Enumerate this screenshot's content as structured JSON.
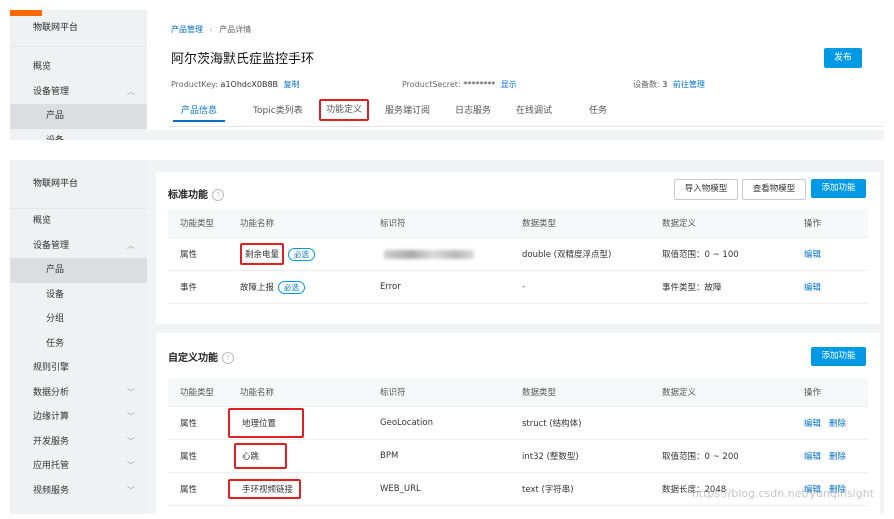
{
  "top": {
    "brand": "物联网平台",
    "nav": [
      "概览",
      "设备管理",
      "产品",
      "设备"
    ],
    "breadcrumb": {
      "parent": "产品管理",
      "sep": "›",
      "current": "产品详情"
    },
    "title": "阿尔茨海默氏症监控手环",
    "publish": "发布",
    "product_key_label": "ProductKey:",
    "product_key": "a1OhdcX0B8B",
    "copy": "复制",
    "product_secret_label": "ProductSecret:",
    "product_secret": "********",
    "show": "显示",
    "device_count_label": "设备数:",
    "device_count": "3",
    "manage": "前往管理",
    "tabs": [
      "产品信息",
      "Topic类列表",
      "功能定义",
      "服务端订阅",
      "日志服务",
      "在线调试",
      "任务"
    ]
  },
  "bottom": {
    "brand": "物联网平台",
    "nav": [
      "概览",
      "设备管理",
      "产品",
      "设备",
      "分组",
      "任务",
      "规则引擎",
      "数据分析",
      "边缘计算",
      "开发服务",
      "应用托管",
      "视频服务"
    ],
    "standard": {
      "title": "标准功能",
      "import": "导入物模型",
      "view": "查看物模型",
      "add": "添加功能",
      "headers": [
        "功能类型",
        "功能名称",
        "标识符",
        "数据类型",
        "数据定义",
        "操作"
      ],
      "rows": [
        {
          "type": "属性",
          "name": "剩余电量",
          "tag": "必选",
          "id": "",
          "dtype": "double (双精度浮点型)",
          "def": "取值范围：0 ~ 100",
          "ops": [
            "编辑"
          ]
        },
        {
          "type": "事件",
          "name": "故障上报",
          "tag": "必选",
          "id": "Error",
          "dtype": "-",
          "def": "事件类型：故障",
          "ops": [
            "编辑"
          ]
        }
      ]
    },
    "custom": {
      "title": "自定义功能",
      "add": "添加功能",
      "headers": [
        "功能类型",
        "功能名称",
        "标识符",
        "数据类型",
        "数据定义",
        "操作"
      ],
      "rows": [
        {
          "type": "属性",
          "name": "地理位置",
          "id": "GeoLocation",
          "dtype": "struct (结构体)",
          "def": "",
          "ops": [
            "编辑",
            "删除"
          ]
        },
        {
          "type": "属性",
          "name": "心跳",
          "id": "BPM",
          "dtype": "int32 (整数型)",
          "def": "取值范围：0 ~ 200",
          "ops": [
            "编辑",
            "删除"
          ]
        },
        {
          "type": "属性",
          "name": "手环视频链接",
          "id": "WEB_URL",
          "dtype": "text (字符串)",
          "def": "数据长度：2048",
          "ops": [
            "编辑",
            "删除"
          ]
        }
      ]
    },
    "watermark": "https://blog.csdn.net/yunqinsight"
  }
}
